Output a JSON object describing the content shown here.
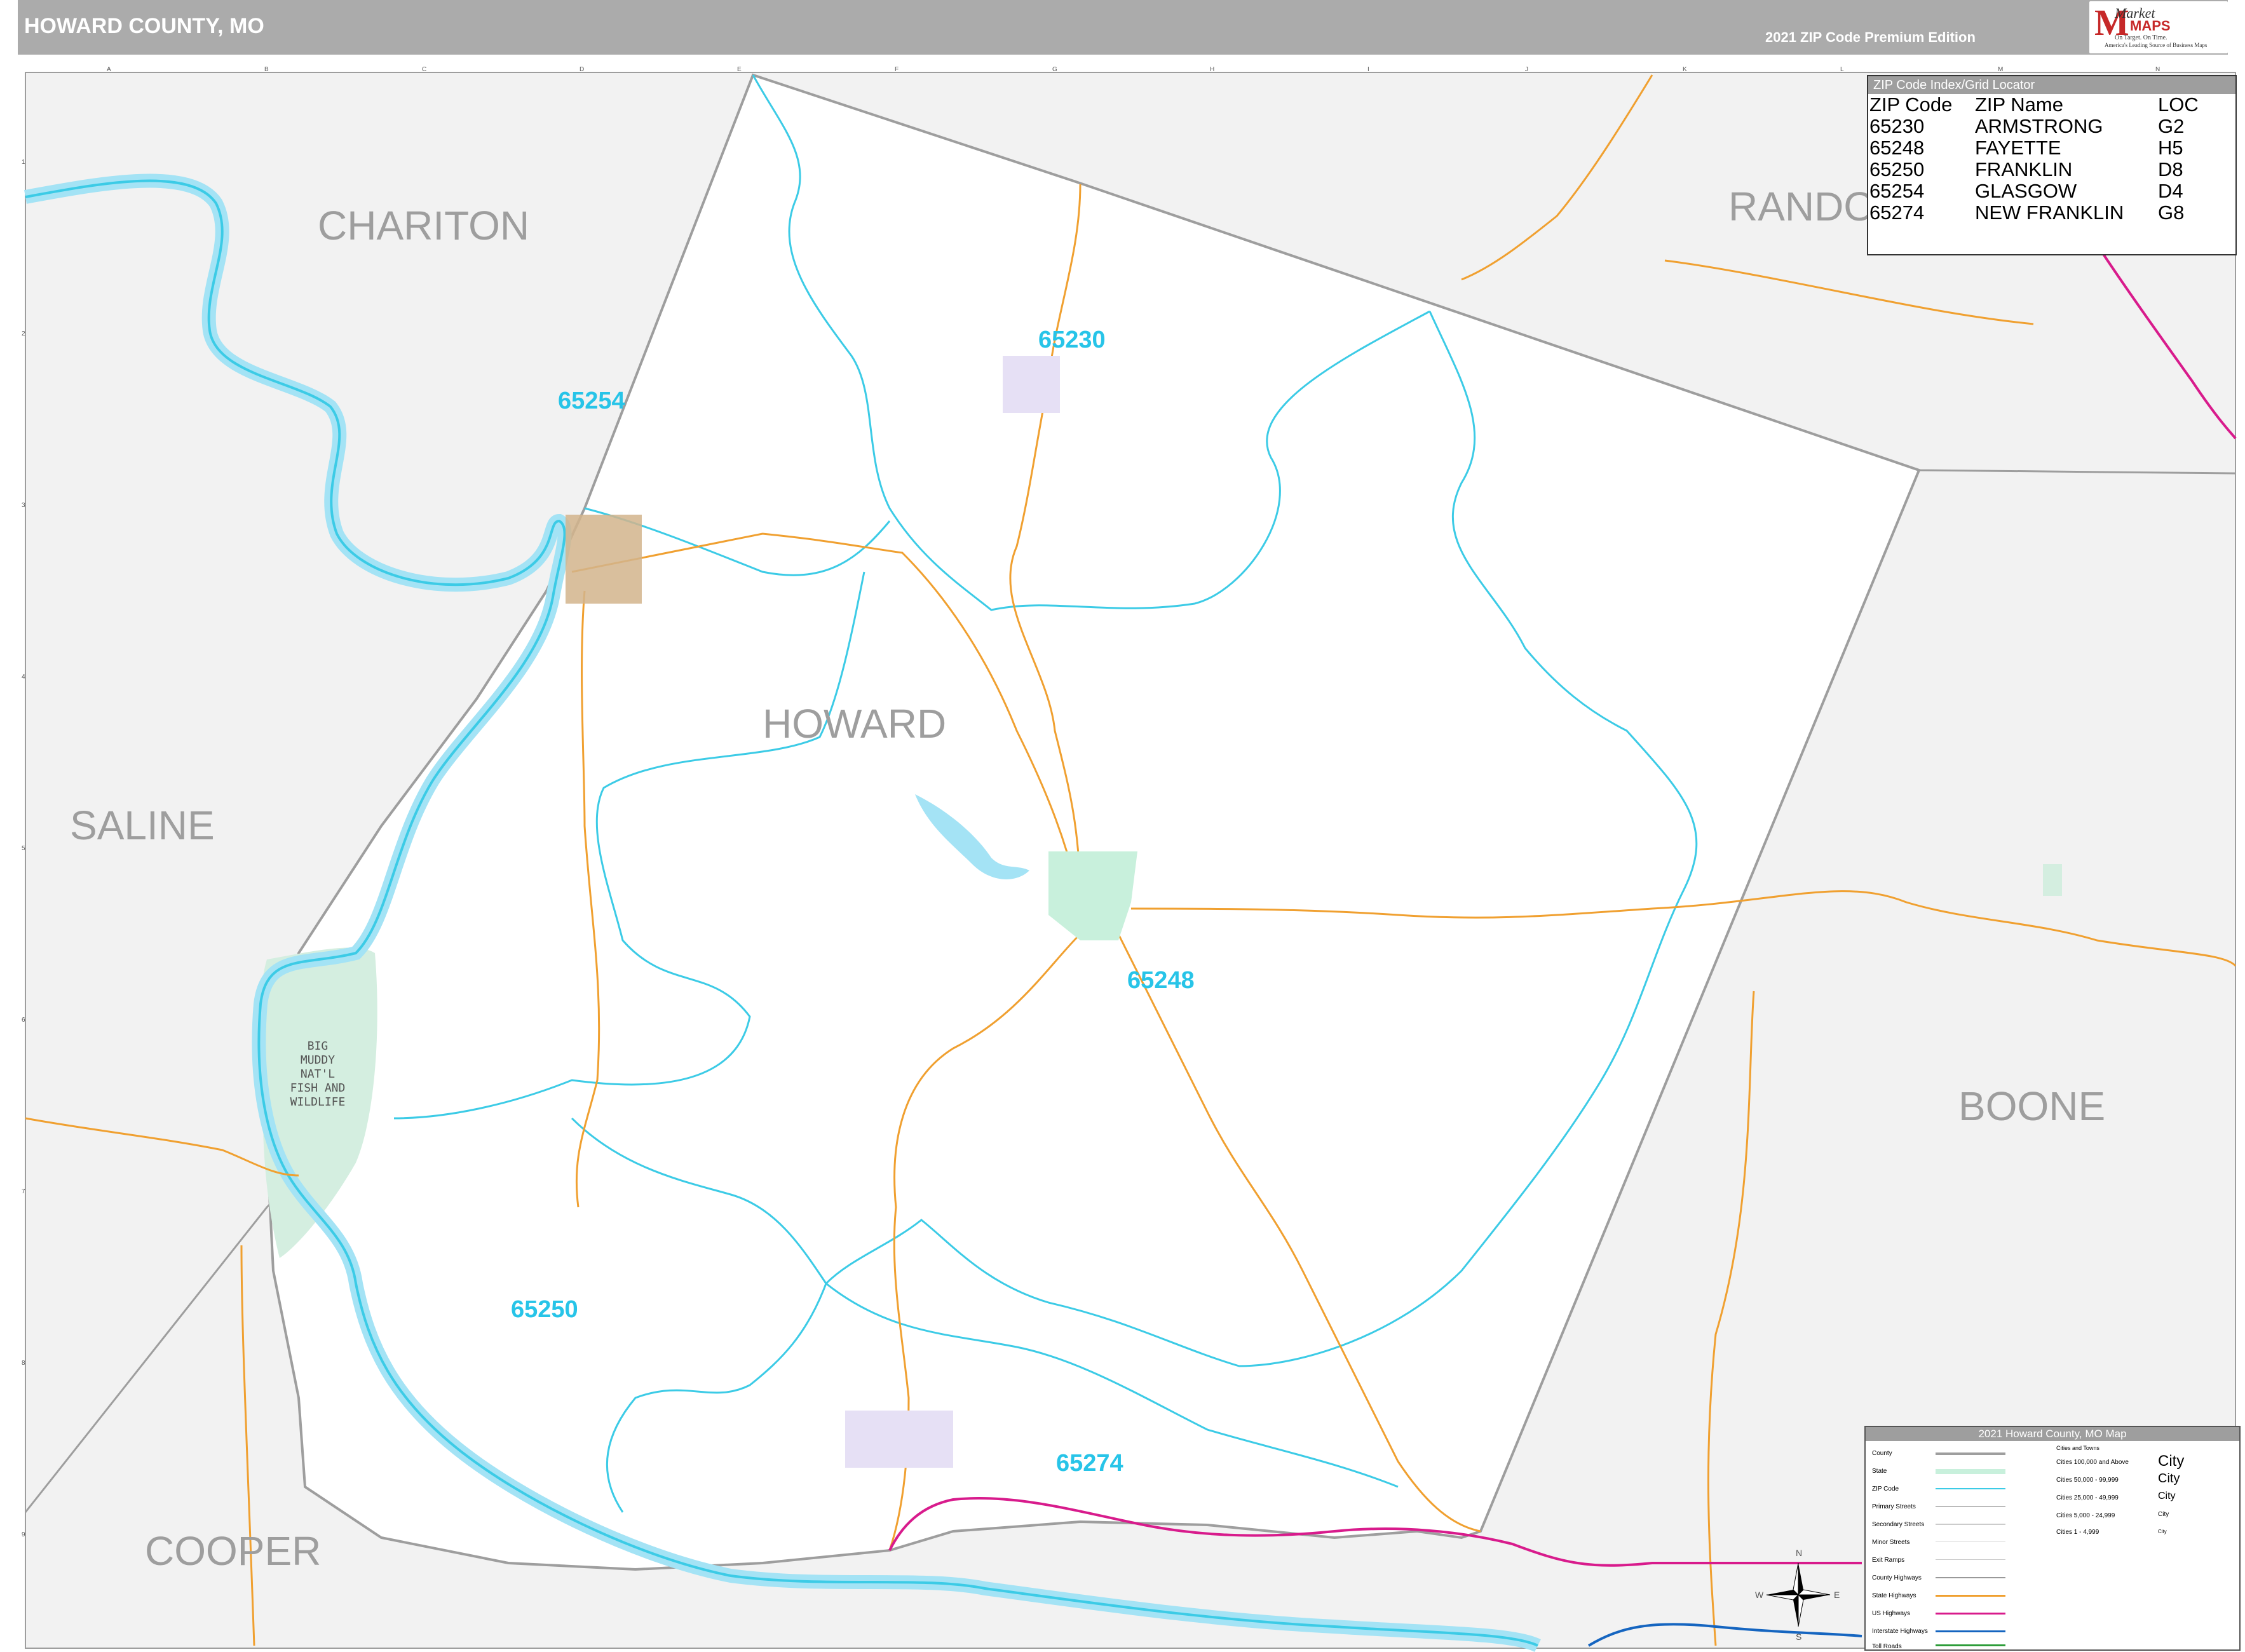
{
  "header": {
    "title": "HOWARD COUNTY, MO",
    "edition": "2021 ZIP Code Premium Edition"
  },
  "logo": {
    "market": "Market",
    "maps": "MAPS",
    "tagline": "On Target. On Time.",
    "tagline2": "America's Leading Source of Business Maps"
  },
  "county_labels": {
    "chariton": "CHARITON",
    "randolph": "RANDO",
    "howard": "HOWARD",
    "saline": "SALINE",
    "boone": "BOONE",
    "cooper": "COOPER"
  },
  "zip_labels": {
    "z65230": "65230",
    "z65254": "65254",
    "z65248": "65248",
    "z65250": "65250",
    "z65274": "65274"
  },
  "wildlife_label": [
    "BIG",
    "MUDDY",
    "NAT'L",
    "FISH AND",
    "WILDLIFE"
  ],
  "zip_index": {
    "title": "ZIP Code Index/Grid Locator",
    "headers": [
      "ZIP Code",
      "ZIP Name",
      "LOC"
    ],
    "rows": [
      [
        "65230",
        "ARMSTRONG",
        "G2"
      ],
      [
        "65248",
        "FAYETTE",
        "H5"
      ],
      [
        "65250",
        "FRANKLIN",
        "D8"
      ],
      [
        "65254",
        "GLASGOW",
        "D4"
      ],
      [
        "65274",
        "NEW FRANKLIN",
        "G8"
      ]
    ]
  },
  "legend": {
    "title": "2021 Howard County, MO Map",
    "cities_head": "Cities and Towns",
    "items": [
      "County",
      "State",
      "ZIP Code",
      "Primary Streets",
      "Secondary Streets",
      "Minor Streets",
      "Exit Ramps",
      "County Highways",
      "State Highways",
      "US Highways",
      "Interstate Highways",
      "Toll Roads"
    ],
    "city_classes": [
      "Cities 100,000 and Above",
      "Cities 50,000 - 99,999",
      "Cities 25,000 - 49,999",
      "Cities 5,000 - 24,999",
      "Cities 1 - 4,999"
    ],
    "city_samples": [
      "City",
      "City",
      "City",
      "City",
      "City"
    ]
  },
  "grid": {
    "columns": [
      "A",
      "B",
      "C",
      "D",
      "E",
      "F",
      "G",
      "H",
      "I",
      "J",
      "K",
      "L",
      "M",
      "N"
    ],
    "rows": [
      "1",
      "2",
      "3",
      "4",
      "5",
      "6",
      "7",
      "8",
      "9"
    ]
  },
  "compass": [
    "N",
    "E",
    "S",
    "W"
  ],
  "colors": {
    "river": "#a4e3f5",
    "zip_boundary": "#3ccbe6",
    "county_boundary": "#9e9e9e",
    "state_highway": "#f0a030",
    "us_highway": "#d81b8c",
    "interstate": "#1565c0",
    "wildlife_area": "#d4eee0",
    "outside_county": "#f2f2f2"
  }
}
